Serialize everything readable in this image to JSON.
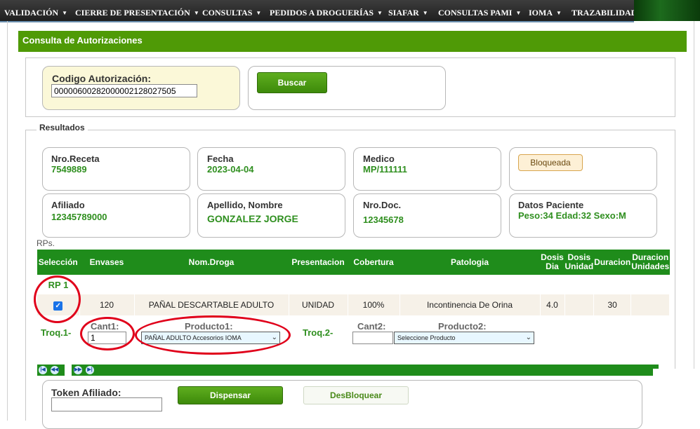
{
  "nav": {
    "items": [
      {
        "label": "VALIDACIÓN",
        "chevron": true
      },
      {
        "label": "CIERRE DE PRESENTACIÓN",
        "chevron": true
      },
      {
        "label": "CONSULTAS",
        "chevron": true
      },
      {
        "label": "PEDIDOS A DROGUERÍAS",
        "chevron": true
      },
      {
        "label": "SIAFAR",
        "chevron": true
      },
      {
        "label": "CONSULTAS PAMI",
        "chevron": true
      },
      {
        "label": "IOMA",
        "chevron": true
      },
      {
        "label": "TRAZABILIDAD",
        "chevron": false
      }
    ]
  },
  "page": {
    "title": "Consulta de Autorizaciones"
  },
  "search": {
    "label": "Codigo Autorización:",
    "value": "000006002820000021280275​05",
    "button": "Buscar"
  },
  "results": {
    "legend": "Resultados",
    "nro_receta": {
      "label": "Nro.Receta",
      "value": "7549889"
    },
    "fecha": {
      "label": "Fecha",
      "value": "2023-04-04"
    },
    "medico": {
      "label": "Medico",
      "value": "MP/111111"
    },
    "estado": {
      "label": "Bloqueada"
    },
    "afiliado": {
      "label": "Afiliado",
      "value": "12345789000"
    },
    "apellido": {
      "label": "Apellido, Nombre",
      "value": "GONZALEZ JORGE"
    },
    "nro_doc": {
      "label": "Nro.Doc.",
      "value": "12345678"
    },
    "paciente": {
      "label": "Datos Paciente",
      "value": "Peso:34 Edad:32 Sexo:M"
    }
  },
  "rps": {
    "label": "RPs.",
    "headers": [
      "Selección",
      "Envases",
      "Nom.Droga",
      "Presentacion",
      "Cobertura",
      "Patologia",
      "Dosis Dia",
      "Dosis Unidad",
      "Duracion",
      "Duracion Unidades"
    ],
    "rp_label": "RP 1",
    "row": {
      "selected": true,
      "envases": "120",
      "droga": "PAÑAL DESCARTABLE ADULTO",
      "presentacion": "UNIDAD",
      "cobertura": "100%",
      "patologia": "Incontinencia De Orina",
      "dosis_dia": "4.0",
      "dosis_unidad": "",
      "duracion": "30",
      "duracion_unidades": ""
    },
    "troq1": "Troq.1-",
    "cant1_label": "Cant1:",
    "cant1_value": "1",
    "producto1_label": "Producto1:",
    "producto1_value": "PAÑAL ADULTO Accesorios IOMA",
    "troq2": "Troq.2-",
    "cant2_label": "Cant2:",
    "cant2_value": "",
    "producto2_label": "Producto2:",
    "producto2_value": "Seleccione Producto"
  },
  "token": {
    "label": "Token Afiliado:",
    "value": "",
    "dispensar": "Dispensar",
    "desbloquear": "DesBloquear"
  },
  "colors": {
    "accent_green": "#4f9a06",
    "header_green": "#1f8c1b",
    "value_green": "#2f8f1f",
    "annotation_red": "#e0001a"
  }
}
